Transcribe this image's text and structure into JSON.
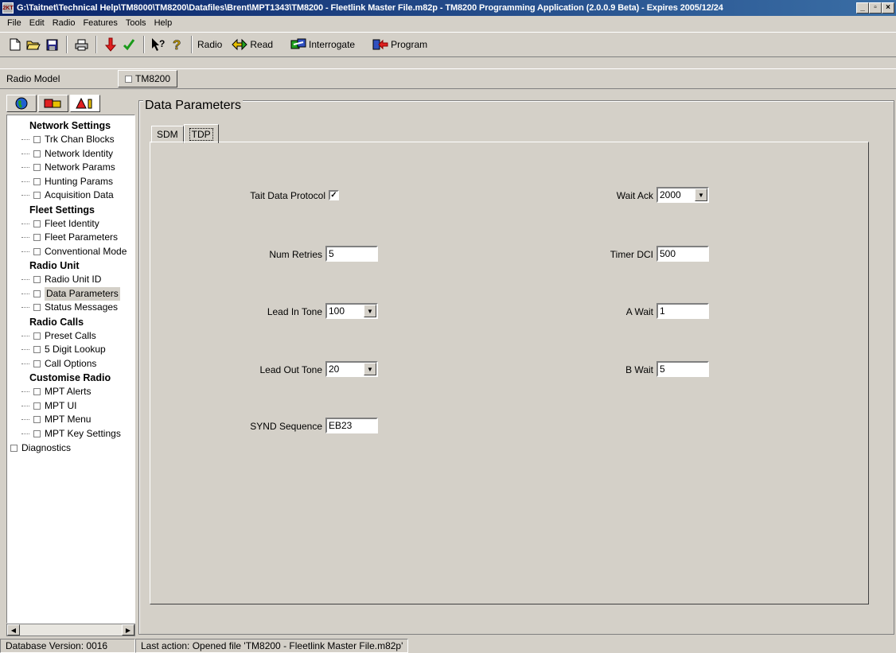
{
  "window": {
    "app_icon": "2KT",
    "title": "G:\\Taitnet\\Technical Help\\TM8000\\TM8200\\Datafiles\\Brent\\MPT1343\\TM8200 - Fleetlink Master File.m82p - TM8200 Programming Application (2.0.0.9 Beta) - Expires 2005/12/24",
    "minimize": "_",
    "maximize": "▫",
    "close": "×"
  },
  "menu": [
    "File",
    "Edit",
    "Radio",
    "Features",
    "Tools",
    "Help"
  ],
  "toolbar": {
    "radio_label": "Radio",
    "read_label": "Read",
    "interrogate_label": "Interrogate",
    "program_label": "Program"
  },
  "model_bar": {
    "label": "Radio Model",
    "tab": "TM8200"
  },
  "tree": {
    "groups": [
      {
        "title": "Network Settings",
        "items": [
          "Trk Chan Blocks",
          "Network Identity",
          "Network Params",
          "Hunting Params",
          "Acquisition Data"
        ]
      },
      {
        "title": "Fleet Settings",
        "items": [
          "Fleet Identity",
          "Fleet Parameters",
          "Conventional Mode"
        ]
      },
      {
        "title": "Radio Unit",
        "items": [
          "Radio Unit ID",
          "Data Parameters",
          "Status Messages"
        ]
      },
      {
        "title": "Radio Calls",
        "items": [
          "Preset Calls",
          "5 Digit Lookup",
          "Call Options"
        ]
      },
      {
        "title": "Customise Radio",
        "items": [
          "MPT Alerts",
          "MPT UI",
          "MPT Menu",
          "MPT Key Settings"
        ]
      }
    ],
    "root": "Diagnostics",
    "selected": "Data Parameters"
  },
  "panel": {
    "title": "Data Parameters",
    "tabs": [
      "SDM",
      "TDP"
    ],
    "active_tab": "TDP"
  },
  "fields": {
    "tait_data_protocol_label": "Tait Data Protocol",
    "tait_data_protocol_checked": "✓",
    "num_retries_label": "Num Retries",
    "num_retries_value": "5",
    "lead_in_tone_label": "Lead In Tone",
    "lead_in_tone_value": "100",
    "lead_out_tone_label": "Lead Out Tone",
    "lead_out_tone_value": "20",
    "synd_sequence_label": "SYND Sequence",
    "synd_sequence_value": "EB23",
    "wait_ack_label": "Wait Ack",
    "wait_ack_value": "2000",
    "timer_dci_label": "Timer DCI",
    "timer_dci_value": "500",
    "a_wait_label": "A Wait",
    "a_wait_value": "1",
    "b_wait_label": "B Wait",
    "b_wait_value": "5"
  },
  "status": {
    "db_version": "Database Version: 0016",
    "last_action": "Last action: Opened file 'TM8200 - Fleetlink Master File.m82p'"
  }
}
